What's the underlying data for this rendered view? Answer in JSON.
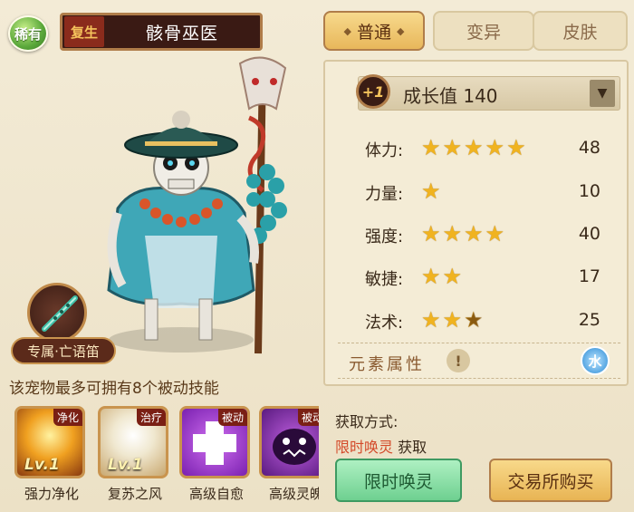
{
  "header": {
    "rarity": "稀有",
    "reborn_tag": "复生",
    "pet_name": "骸骨巫医"
  },
  "tabs": [
    {
      "label": "普通",
      "active": true
    },
    {
      "label": "变异",
      "active": false
    },
    {
      "label": "皮肤",
      "active": false
    }
  ],
  "growth": {
    "badge": "+1",
    "label": "成长值 140"
  },
  "attributes": [
    {
      "label": "体力:",
      "stars": 5,
      "value": "48"
    },
    {
      "label": "力量:",
      "stars": 1,
      "value": "10"
    },
    {
      "label": "强度:",
      "stars": 4,
      "value": "40"
    },
    {
      "label": "敏捷:",
      "stars": 2,
      "value": "17"
    },
    {
      "label": "法术:",
      "stars": 2.5,
      "value": "25"
    }
  ],
  "element": {
    "label": "元素属性",
    "info_icon": "!",
    "badge": "水"
  },
  "weapon": {
    "label": "专属·亡语笛"
  },
  "skills_caption": "该宠物最多可拥有8个被动技能",
  "skills": [
    {
      "name": "强力净化",
      "tag": "净化",
      "level": "Lv.1"
    },
    {
      "name": "复苏之风",
      "tag": "治疗",
      "level": "Lv.1"
    },
    {
      "name": "高级自愈",
      "tag": "被动",
      "level": ""
    },
    {
      "name": "高级灵魄",
      "tag": "被动",
      "level": ""
    }
  ],
  "acquire": {
    "title": "获取方式:",
    "source_highlight": "限时唤灵",
    "source_suffix": " 获取"
  },
  "buttons": {
    "summon": "限时唤灵",
    "trade": "交易所购买"
  }
}
